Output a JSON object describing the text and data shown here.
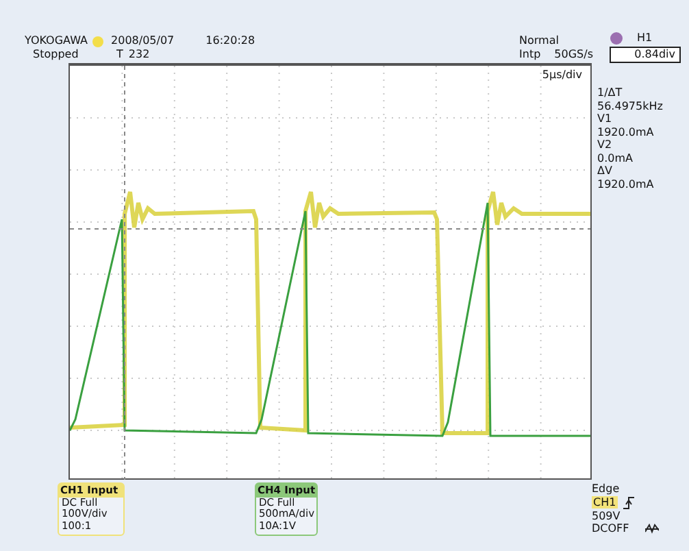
{
  "header": {
    "brand": "YOKOGAWA",
    "state": "Stopped",
    "date": "2008/05/07",
    "time": "16:20:28",
    "trigger_mark": "T",
    "record": "232",
    "mode": "Normal",
    "sampling": "Intp",
    "rate": "50GS/s",
    "timebase": "5µs/div"
  },
  "cursor": {
    "label": "H1",
    "value": "0.84div",
    "color": "#9b6fb0"
  },
  "measurements": [
    "1/ΔT",
    "56.4975kHz",
    "V1",
    "1920.0mA",
    "V2",
    "0.0mA",
    "ΔV",
    "1920.0mA"
  ],
  "channels": [
    {
      "title": "CH1 Input",
      "lines": [
        "DC Full",
        "100V/div",
        "100:1"
      ],
      "color": "#f0e27a"
    },
    {
      "title": "CH4 Input",
      "lines": [
        "DC Full",
        "500mA/div",
        "10A:1V"
      ],
      "color": "#8cc87a"
    }
  ],
  "trigger": {
    "type": "Edge",
    "source": "CH1",
    "level": "509V",
    "coupling": "DCOFF"
  }
}
